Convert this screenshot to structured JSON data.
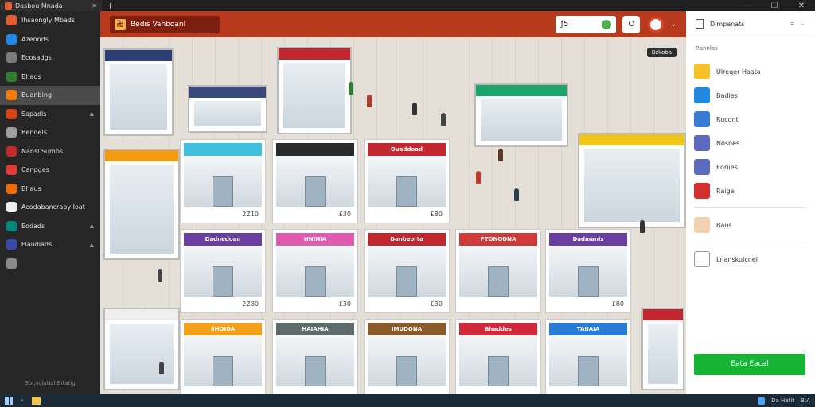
{
  "window": {
    "tab_label": "Dasbou Mnada",
    "new_tab": "+",
    "minimize": "—",
    "maximize": "☐",
    "close": "✕"
  },
  "sidebar": {
    "items": [
      {
        "label": "Ihsaongly Mbads",
        "color": "#e55b2f",
        "icon": "app-icon"
      },
      {
        "label": "Azennds",
        "color": "#1e88e5",
        "icon": "globe-icon"
      },
      {
        "label": "Ecosadgs",
        "color": "#7b7b7b",
        "icon": "store-icon"
      },
      {
        "label": "Bhads",
        "color": "#2e7d32",
        "icon": "chart-icon"
      },
      {
        "label": "Buanbing",
        "color": "#f57c00",
        "icon": "shop-icon",
        "active": true
      },
      {
        "label": "Sapadls",
        "color": "#d84315",
        "icon": "book-icon",
        "pinned": true
      },
      {
        "label": "Bendels",
        "color": "#9e9e9e",
        "icon": "settings-icon"
      },
      {
        "label": "Nansl Sumbs",
        "color": "#c62828",
        "icon": "tag-icon"
      },
      {
        "label": "Canpges",
        "color": "#e53935",
        "icon": "calendar-icon"
      },
      {
        "label": "Bhaus",
        "color": "#ef6c00",
        "icon": "bag-icon"
      },
      {
        "label": "Acodabancraby Ioat",
        "color": "#eeeeee",
        "icon": "person-icon"
      },
      {
        "label": "Eodads",
        "color": "#00897b",
        "icon": "card-icon",
        "pinned": true
      },
      {
        "label": "Flaudlads",
        "color": "#3949ab",
        "icon": "mail-icon",
        "pinned": true
      },
      {
        "label": "",
        "color": "#8a8a8a",
        "icon": "more-icon"
      }
    ],
    "footer": "Sbcnclatial Bitatig"
  },
  "header": {
    "brand": "Bedis Vanboanl",
    "search_value": "ƒ5",
    "menu_glyph": "O",
    "chevron": "⌄"
  },
  "canvas": {
    "badge": "Bzkoba"
  },
  "store_cards": [
    {
      "sign": "",
      "color": "#3fbfe0",
      "price": "2Z10"
    },
    {
      "sign": "",
      "color": "#2a2a2a",
      "price": "£30"
    },
    {
      "sign": "Duaddoad",
      "color": "#c2262e",
      "price": "£80"
    },
    {
      "sign": "Dadnedoan",
      "color": "#6b3fa0",
      "price": "2Z80"
    },
    {
      "sign": "HNIHIA",
      "color": "#e05ab0",
      "price": "£30"
    },
    {
      "sign": "Danbeorta",
      "color": "#c2262e",
      "price": "£30"
    },
    {
      "sign": "PTONODNA",
      "color": "#d23a3a",
      "price": ""
    },
    {
      "sign": "Dadmanis",
      "color": "#6b3fa0",
      "price": "£80"
    },
    {
      "sign": "SHOIDA",
      "color": "#f3a11b",
      "price": ""
    },
    {
      "sign": "HAIAHIA",
      "color": "#5d6b6b",
      "price": ""
    },
    {
      "sign": "IMUDONA",
      "color": "#8b5a2b",
      "price": ""
    },
    {
      "sign": "Bhaddes",
      "color": "#d1283a",
      "price": ""
    },
    {
      "sign": "TAIIAIA",
      "color": "#2a7bd6",
      "price": ""
    }
  ],
  "panel": {
    "title": "Dimpanats",
    "subtitle": "Rannlas",
    "items": [
      {
        "label": "Ulreqer Haata",
        "color": "#f6c22c",
        "icon": "bag-icon"
      },
      {
        "label": "Badies",
        "color": "#1e88e5",
        "icon": "cart-icon"
      },
      {
        "label": "Rucont",
        "color": "#3a7bd5",
        "icon": "shop-icon"
      },
      {
        "label": "Nosnes",
        "color": "#5c6bc0",
        "icon": "person-icon"
      },
      {
        "label": "Eoriies",
        "color": "#5b6abf",
        "icon": "coupon-icon"
      },
      {
        "label": "Raige",
        "color": "#d32f2f",
        "icon": "flag-icon"
      },
      {
        "label": "Baus",
        "color": "#f3d2b3",
        "icon": "gift-icon"
      },
      {
        "label": "Lnanskulcnel",
        "color": "#ffffff",
        "icon": "cloud-icon"
      }
    ],
    "action": "Eata Eacal"
  },
  "taskbar": {
    "app_label": "Da Hatit",
    "tray_time": "B:A"
  }
}
